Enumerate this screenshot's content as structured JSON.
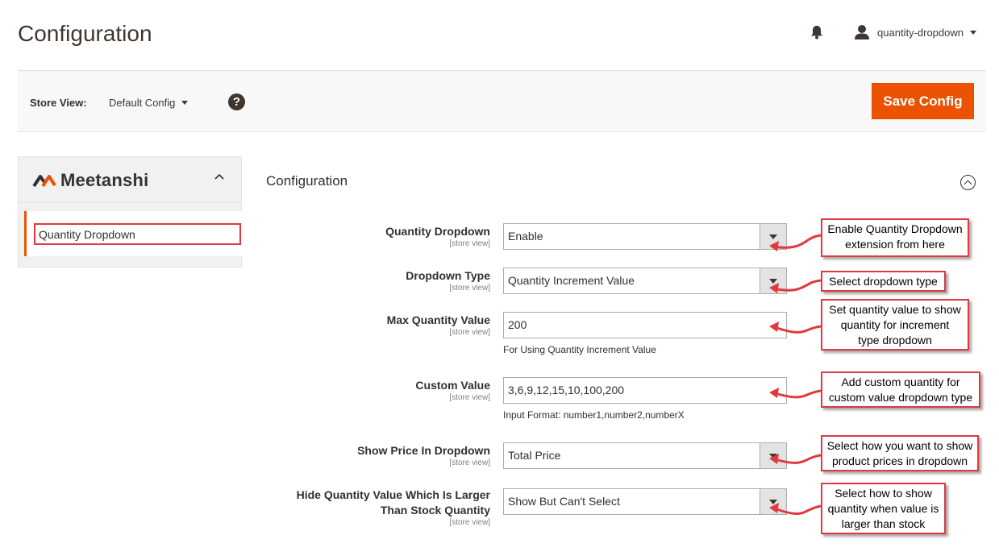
{
  "header": {
    "title": "Configuration",
    "user_name": "quantity-dropdown"
  },
  "toolbar": {
    "store_view_label": "Store View:",
    "store_view_value": "Default Config",
    "help_glyph": "?",
    "save_label": "Save Config"
  },
  "sidebar": {
    "brand": "Meetanshi",
    "items": [
      {
        "label": "Quantity Dropdown"
      }
    ]
  },
  "section": {
    "title": "Configuration"
  },
  "fields": [
    {
      "label": "Quantity Dropdown",
      "scope": "[store view]",
      "value": "Enable",
      "type": "select"
    },
    {
      "label": "Dropdown Type",
      "scope": "[store view]",
      "value": "Quantity Increment Value",
      "type": "select"
    },
    {
      "label": "Max Quantity Value",
      "scope": "[store view]",
      "value": "200",
      "type": "text",
      "note": "For Using Quantity Increment Value"
    },
    {
      "label": "Custom Value",
      "scope": "[store view]",
      "value": "3,6,9,12,15,10,100,200",
      "type": "text",
      "note": "Input Format: number1,number2,numberX"
    },
    {
      "label": "Show Price In Dropdown",
      "scope": "[store view]",
      "value": "Total Price",
      "type": "select"
    },
    {
      "label_line1": "Hide Quantity Value Which Is Larger",
      "label_line2": "Than Stock Quantity",
      "scope": "[store view]",
      "value": "Show But Can't Select",
      "type": "select"
    }
  ],
  "callouts": {
    "c1": {
      "line1": "Enable Quantity Dropdown",
      "line2": "extension from here"
    },
    "c2": {
      "line1": "Select dropdown type"
    },
    "c3": {
      "line1": "Set quantity value to show",
      "line2": "quantity for increment",
      "line3": "type dropdown"
    },
    "c4": {
      "line1": "Add custom quantity for",
      "line2": "custom value dropdown type"
    },
    "c5": {
      "line1": "Select how you want to show",
      "line2": "product prices in dropdown"
    },
    "c6": {
      "line1": "Select how to show",
      "line2": "quantity when value is",
      "line3": "larger than stock"
    }
  },
  "colors": {
    "accent": "#eb5202",
    "annotation_red": "#e0393e",
    "text": "#303030"
  },
  "icons": [
    "bell-icon",
    "user-icon",
    "chevron-down-icon",
    "help-icon",
    "meetanshi-logo-icon",
    "chevron-up-icon",
    "collapse-circle-icon"
  ]
}
